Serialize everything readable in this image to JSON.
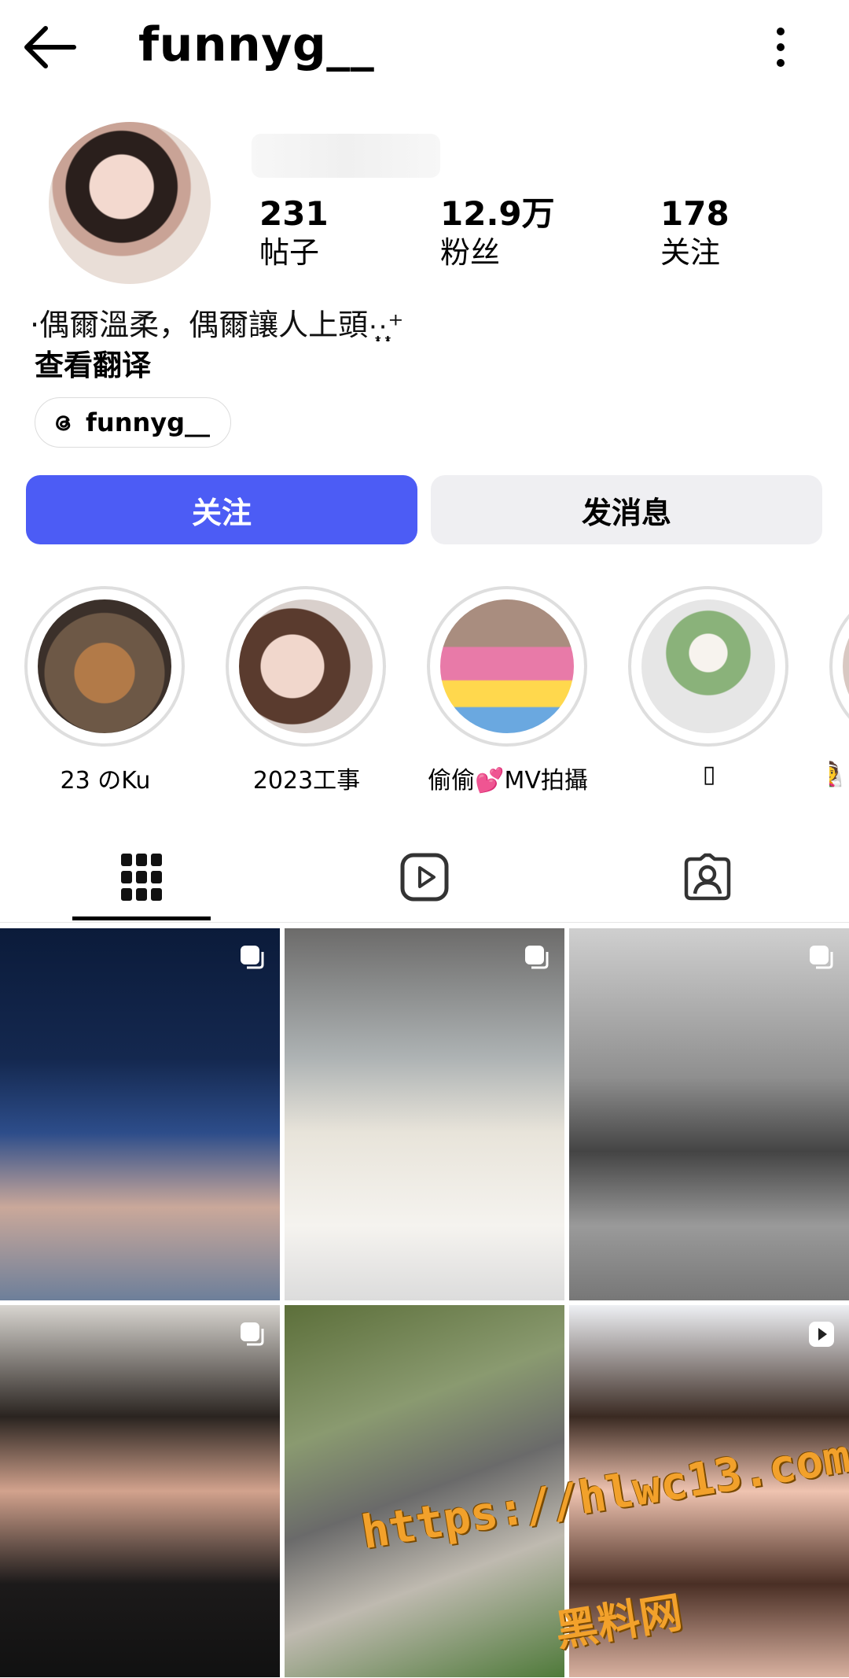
{
  "header": {
    "username": "funnyg__"
  },
  "profile": {
    "stats": [
      {
        "value": "231",
        "label": "帖子"
      },
      {
        "value": "12.9万",
        "label": "粉丝"
      },
      {
        "value": "178",
        "label": "关注"
      }
    ],
    "bio": "·偶爾溫柔，偶爾讓人上頭·̩͙·̩̩͙⁺",
    "see_translation": "查看翻译",
    "threads_handle": "funnyg__"
  },
  "actions": {
    "follow": "关注",
    "message": "发消息"
  },
  "highlights": [
    {
      "caption": "23 のKu"
    },
    {
      "caption": "2023工事"
    },
    {
      "caption": "偷偷💕MV拍攝"
    },
    {
      "caption": "▯"
    },
    {
      "caption": "👰"
    }
  ],
  "tabs": [
    "posts-grid",
    "reels",
    "tagged"
  ],
  "watermark": {
    "url": "https://hlwc13.com",
    "site": "黑料网"
  },
  "colors": {
    "follow_button": "#4c5cf5",
    "message_button": "#efeff2"
  }
}
